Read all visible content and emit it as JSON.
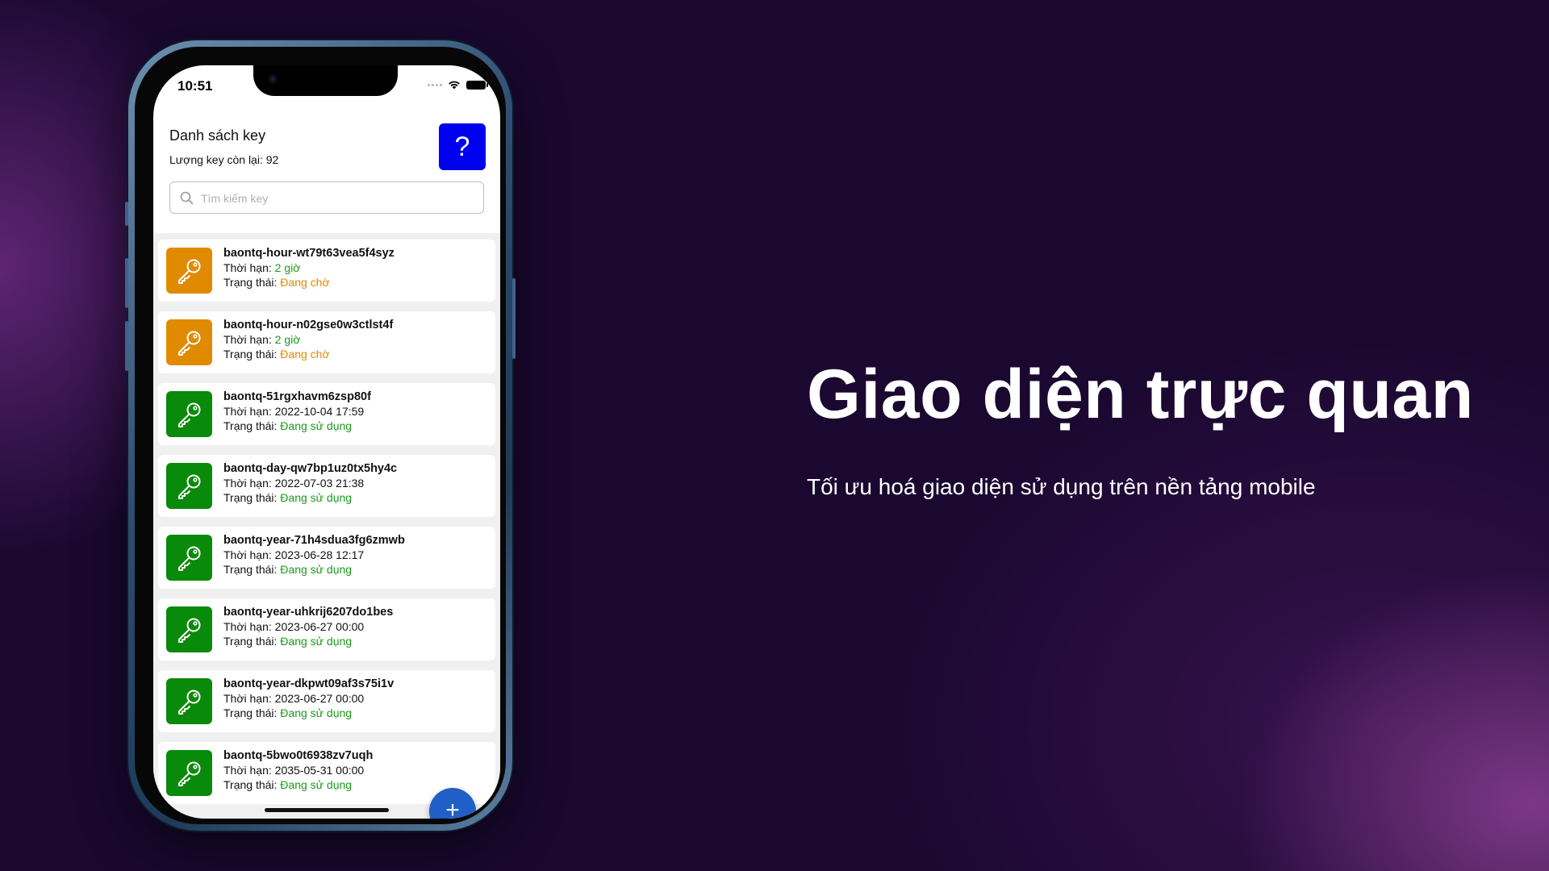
{
  "status_bar": {
    "time": "10:51"
  },
  "header": {
    "title": "Danh sách key",
    "remaining": "Lượng key còn lại: 92",
    "help_label": "?"
  },
  "search": {
    "placeholder": "Tìm kiếm key",
    "value": ""
  },
  "labels": {
    "expiry": "Thời hạn: ",
    "status": "Trạng thái: "
  },
  "colors": {
    "pending_icon": "#e08a00",
    "active_icon": "#0a8a0a",
    "pending_text": "#e08a00",
    "active_text": "#1a9a1a",
    "help_button": "#0000f0",
    "fab": "#1f5fc7"
  },
  "keys": [
    {
      "name": "baontq-hour-wt79t63vea5f4syz",
      "expiry": "2 giờ",
      "expiry_highlight": true,
      "status": "Đang chờ",
      "state": "pending",
      "icon": "key-icon"
    },
    {
      "name": "baontq-hour-n02gse0w3ctlst4f",
      "expiry": "2 giờ",
      "expiry_highlight": true,
      "status": "Đang chờ",
      "state": "pending",
      "icon": "key-icon"
    },
    {
      "name": "baontq-51rgxhavm6zsp80f",
      "expiry": "2022-10-04 17:59",
      "expiry_highlight": false,
      "status": "Đang sử dụng",
      "state": "active",
      "icon": "key-icon"
    },
    {
      "name": "baontq-day-qw7bp1uz0tx5hy4c",
      "expiry": "2022-07-03 21:38",
      "expiry_highlight": false,
      "status": "Đang sử dụng",
      "state": "active",
      "icon": "key-icon"
    },
    {
      "name": "baontq-year-71h4sdua3fg6zmwb",
      "expiry": "2023-06-28 12:17",
      "expiry_highlight": false,
      "status": "Đang sử dụng",
      "state": "active",
      "icon": "key-icon"
    },
    {
      "name": "baontq-year-uhkrij6207do1bes",
      "expiry": "2023-06-27 00:00",
      "expiry_highlight": false,
      "status": "Đang sử dụng",
      "state": "active",
      "icon": "key-icon"
    },
    {
      "name": "baontq-year-dkpwt09af3s75i1v",
      "expiry": "2023-06-27 00:00",
      "expiry_highlight": false,
      "status": "Đang sử dụng",
      "state": "active",
      "icon": "key-icon"
    },
    {
      "name": "baontq-5bwo0t6938zv7uqh",
      "expiry": "2035-05-31 00:00",
      "expiry_highlight": false,
      "status": "Đang sử dụng",
      "state": "active",
      "icon": "key-icon"
    }
  ],
  "fab_label": "+",
  "promo": {
    "headline": "Giao diện trực quan",
    "subline": "Tối ưu hoá giao diện sử dụng trên nền tảng mobile"
  }
}
